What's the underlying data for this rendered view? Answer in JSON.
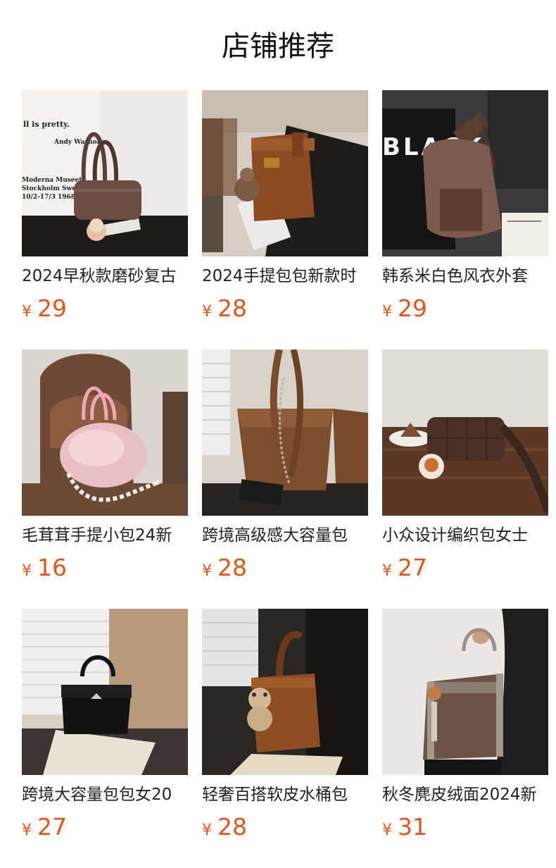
{
  "section": {
    "title": "店铺推荐"
  },
  "colors": {
    "price": "#e0571d",
    "title": "#111111",
    "text": "#222222"
  },
  "products": [
    {
      "name": "2024早秋款磨砂复古",
      "currency": "¥",
      "price": "29",
      "image": "brown-suede-shoulder-bag",
      "print_text": "ll is pretty.",
      "print_text2": "Andy Warhol",
      "print_text3": "Moderna Museet",
      "print_text4": "Stockholm Swed",
      "print_text5": "10/2-17/3 1968"
    },
    {
      "name": "2024手提包包新款时",
      "currency": "¥",
      "price": "28",
      "image": "brown-leather-bucket-bag"
    },
    {
      "name": "韩系米白色风衣外套",
      "currency": "¥",
      "price": "29",
      "image": "brown-suede-hobo-bag",
      "print_text": "BLACK"
    },
    {
      "name": "毛茸茸手提小包24新",
      "currency": "¥",
      "price": "16",
      "image": "pink-fluffy-handbag"
    },
    {
      "name": "跨境高级感大容量包",
      "currency": "¥",
      "price": "28",
      "image": "brown-chain-tote-bag"
    },
    {
      "name": "小众设计编织包女士",
      "currency": "¥",
      "price": "27",
      "image": "brown-woven-shoulder-bag"
    },
    {
      "name": "跨境大容量包包女20",
      "currency": "¥",
      "price": "27",
      "image": "black-leather-tote"
    },
    {
      "name": "轻奢百搭软皮水桶包",
      "currency": "¥",
      "price": "28",
      "image": "brown-leather-bucket-bag-bear"
    },
    {
      "name": "秋冬麂皮绒面2024新",
      "currency": "¥",
      "price": "31",
      "image": "brown-suede-shopper-bag"
    }
  ]
}
